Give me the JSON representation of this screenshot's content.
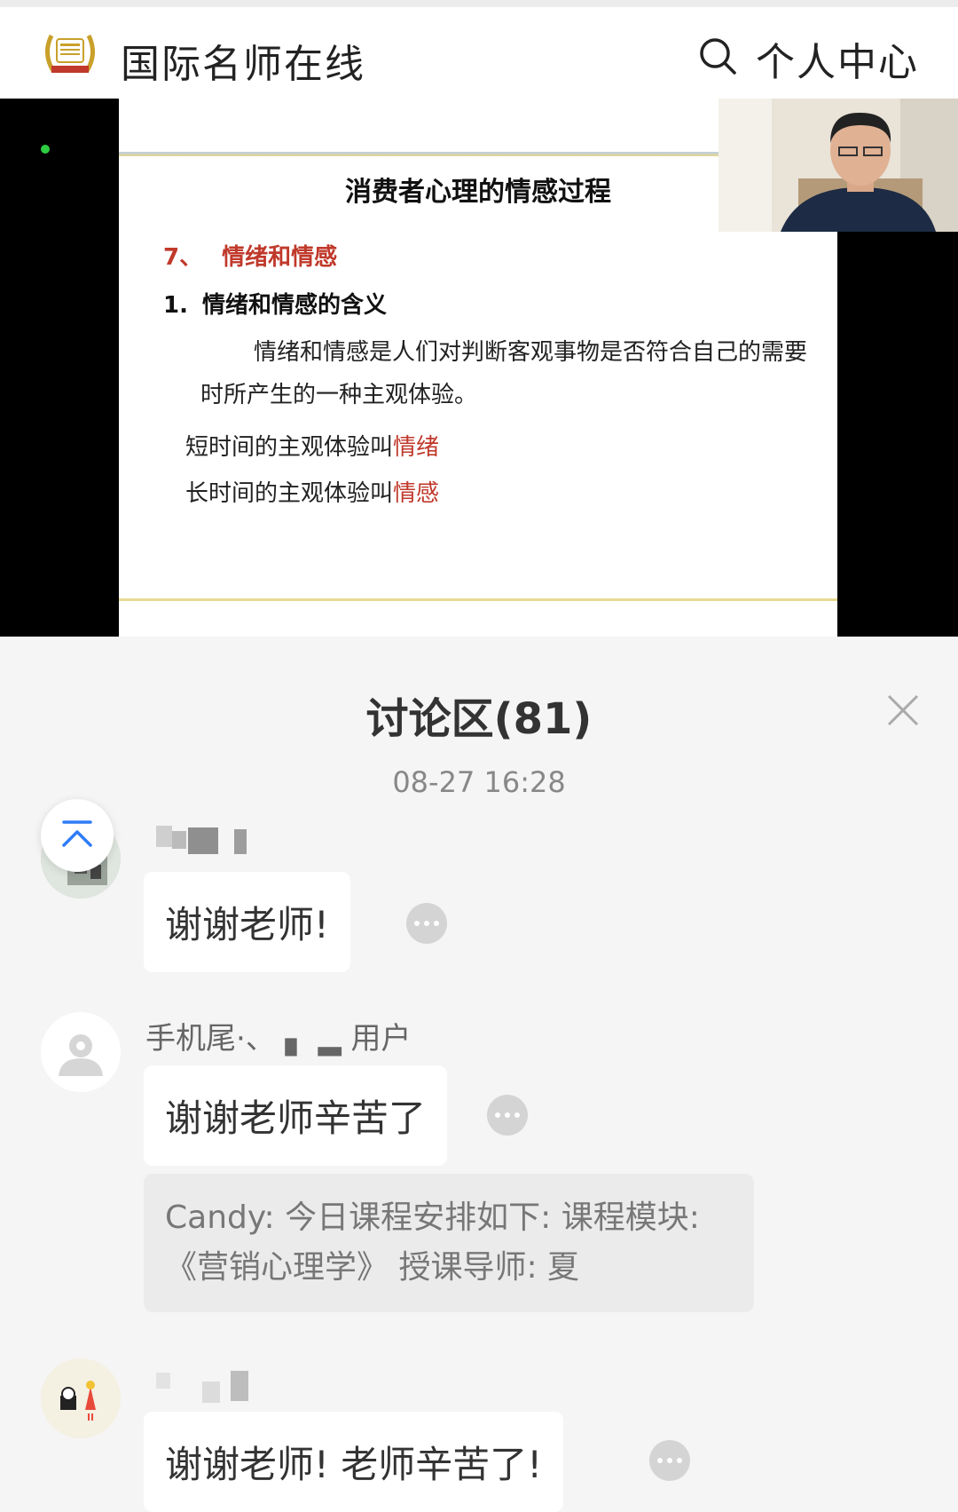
{
  "header": {
    "app_title": "国际名师在线",
    "user_center": "个人中心",
    "icons": {
      "logo": "laurel-logo-icon",
      "search": "search-icon"
    }
  },
  "slide": {
    "title": "消费者心理的情感过程",
    "section_num": "7、",
    "section_title": "情绪和情感",
    "sub_num": "1.",
    "sub_title": "情绪和情感的含义",
    "paragraph": "情绪和情感是人们对判断客观事物是否符合自己的需要时所产生的一种主观体验。",
    "line1_prefix": "短时间的主观体验叫",
    "line1_red": "情绪",
    "line2_prefix": "长时间的主观体验叫",
    "line2_red": "情感"
  },
  "discussion": {
    "title": "讨论区(81)",
    "timestamp": "08-27 16:28",
    "close_icon": "close-icon",
    "scroll_top_icon": "scroll-to-top-icon",
    "messages": [
      {
        "username": "",
        "text": "谢谢老师!"
      },
      {
        "username": "手机尾·、 ▖ ▂ 用户",
        "text": "谢谢老师辛苦了",
        "quote": "Candy: 今日课程安排如下: 课程模块: 《营销心理学》 授课导师: 夏"
      },
      {
        "username": "",
        "text": "谢谢老师! 老师辛苦了!"
      }
    ]
  },
  "colors": {
    "accent_red": "#c0392b",
    "live_dot": "#2ecc40",
    "scroll_top_blue": "#2f7cf6"
  }
}
